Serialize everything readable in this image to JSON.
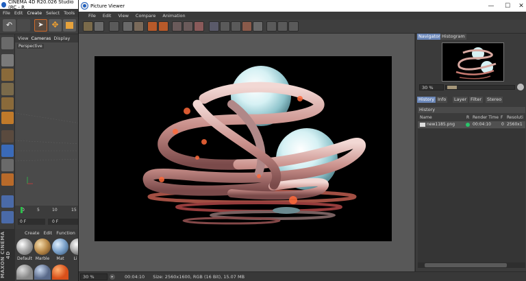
{
  "c4d": {
    "title": "CINEMA 4D R20.026 Studio (RC - R",
    "menu": [
      "File",
      "Edit",
      "Create",
      "Select",
      "Tools"
    ],
    "viewport_menu": [
      "View",
      "Cameras",
      "Display"
    ],
    "viewport_label": "Perspective",
    "timeline_ticks": [
      "0",
      "5",
      "10",
      "15"
    ],
    "frame_fields": [
      "0 F",
      "0 F"
    ],
    "materials_menu": [
      "Create",
      "Edit",
      "Function"
    ],
    "materials": [
      "Default",
      "Marble",
      "Mat",
      "Li"
    ],
    "brand": "MAXON CINEMA 4D"
  },
  "picture_viewer": {
    "title": "Picture Viewer",
    "menu": [
      "File",
      "Edit",
      "View",
      "Compare",
      "Animation"
    ],
    "window_buttons": [
      "—",
      "☐",
      "✕"
    ],
    "navigator_tabs": [
      "Navigator",
      "Histogram"
    ],
    "navigator_zoom": "30 %",
    "navigator_zoom_level": 0.3,
    "history_tabs": [
      "History",
      "Info",
      "Layer",
      "Filter",
      "Stereo"
    ],
    "history_section": "History",
    "history_columns": [
      "Name",
      "R",
      "Render Time",
      "F",
      "Resoluti"
    ],
    "history_item": {
      "name": "new1185.png",
      "render_time": "00:04:10",
      "frame": "0",
      "resolution": "2560x1"
    },
    "status": {
      "zoom": "30 %",
      "time": "00:04:10",
      "info": "Size: 2560x1600, RGB (16 Bit), 15.07 MB"
    }
  },
  "colors": {
    "accent_tab": "#6b87b8",
    "status_dot": "#29c46a"
  }
}
